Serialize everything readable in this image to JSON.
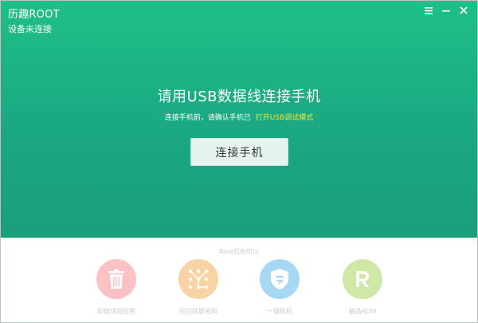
{
  "window": {
    "app_title": "历趣ROOT",
    "device_status": "设备未连接",
    "controls": [
      "menu-icon",
      "minimize-icon",
      "close-icon"
    ]
  },
  "main": {
    "headline": "请用USB数据线连接手机",
    "hint_text": "连接手机前，请确认手机已",
    "hint_link": "打开USB调试模式",
    "connect_button": "连接手机"
  },
  "features": {
    "title": "Root后你可以",
    "items": [
      {
        "label": "卸载顽固应用",
        "icon": "trash-icon",
        "color": "#fac2c4"
      },
      {
        "label": "找回锁屏密码",
        "icon": "pattern-lock-icon",
        "color": "#fad3a4"
      },
      {
        "label": "一键刷机",
        "icon": "shield-icon",
        "color": "#a6d7f3"
      },
      {
        "label": "精品ROM",
        "icon": "rom-r-icon",
        "color": "#cfe8a6"
      }
    ]
  },
  "colors": {
    "accent_top": "#1fbf88",
    "accent_bottom": "#1a9e7c",
    "link": "#f2e63d"
  }
}
